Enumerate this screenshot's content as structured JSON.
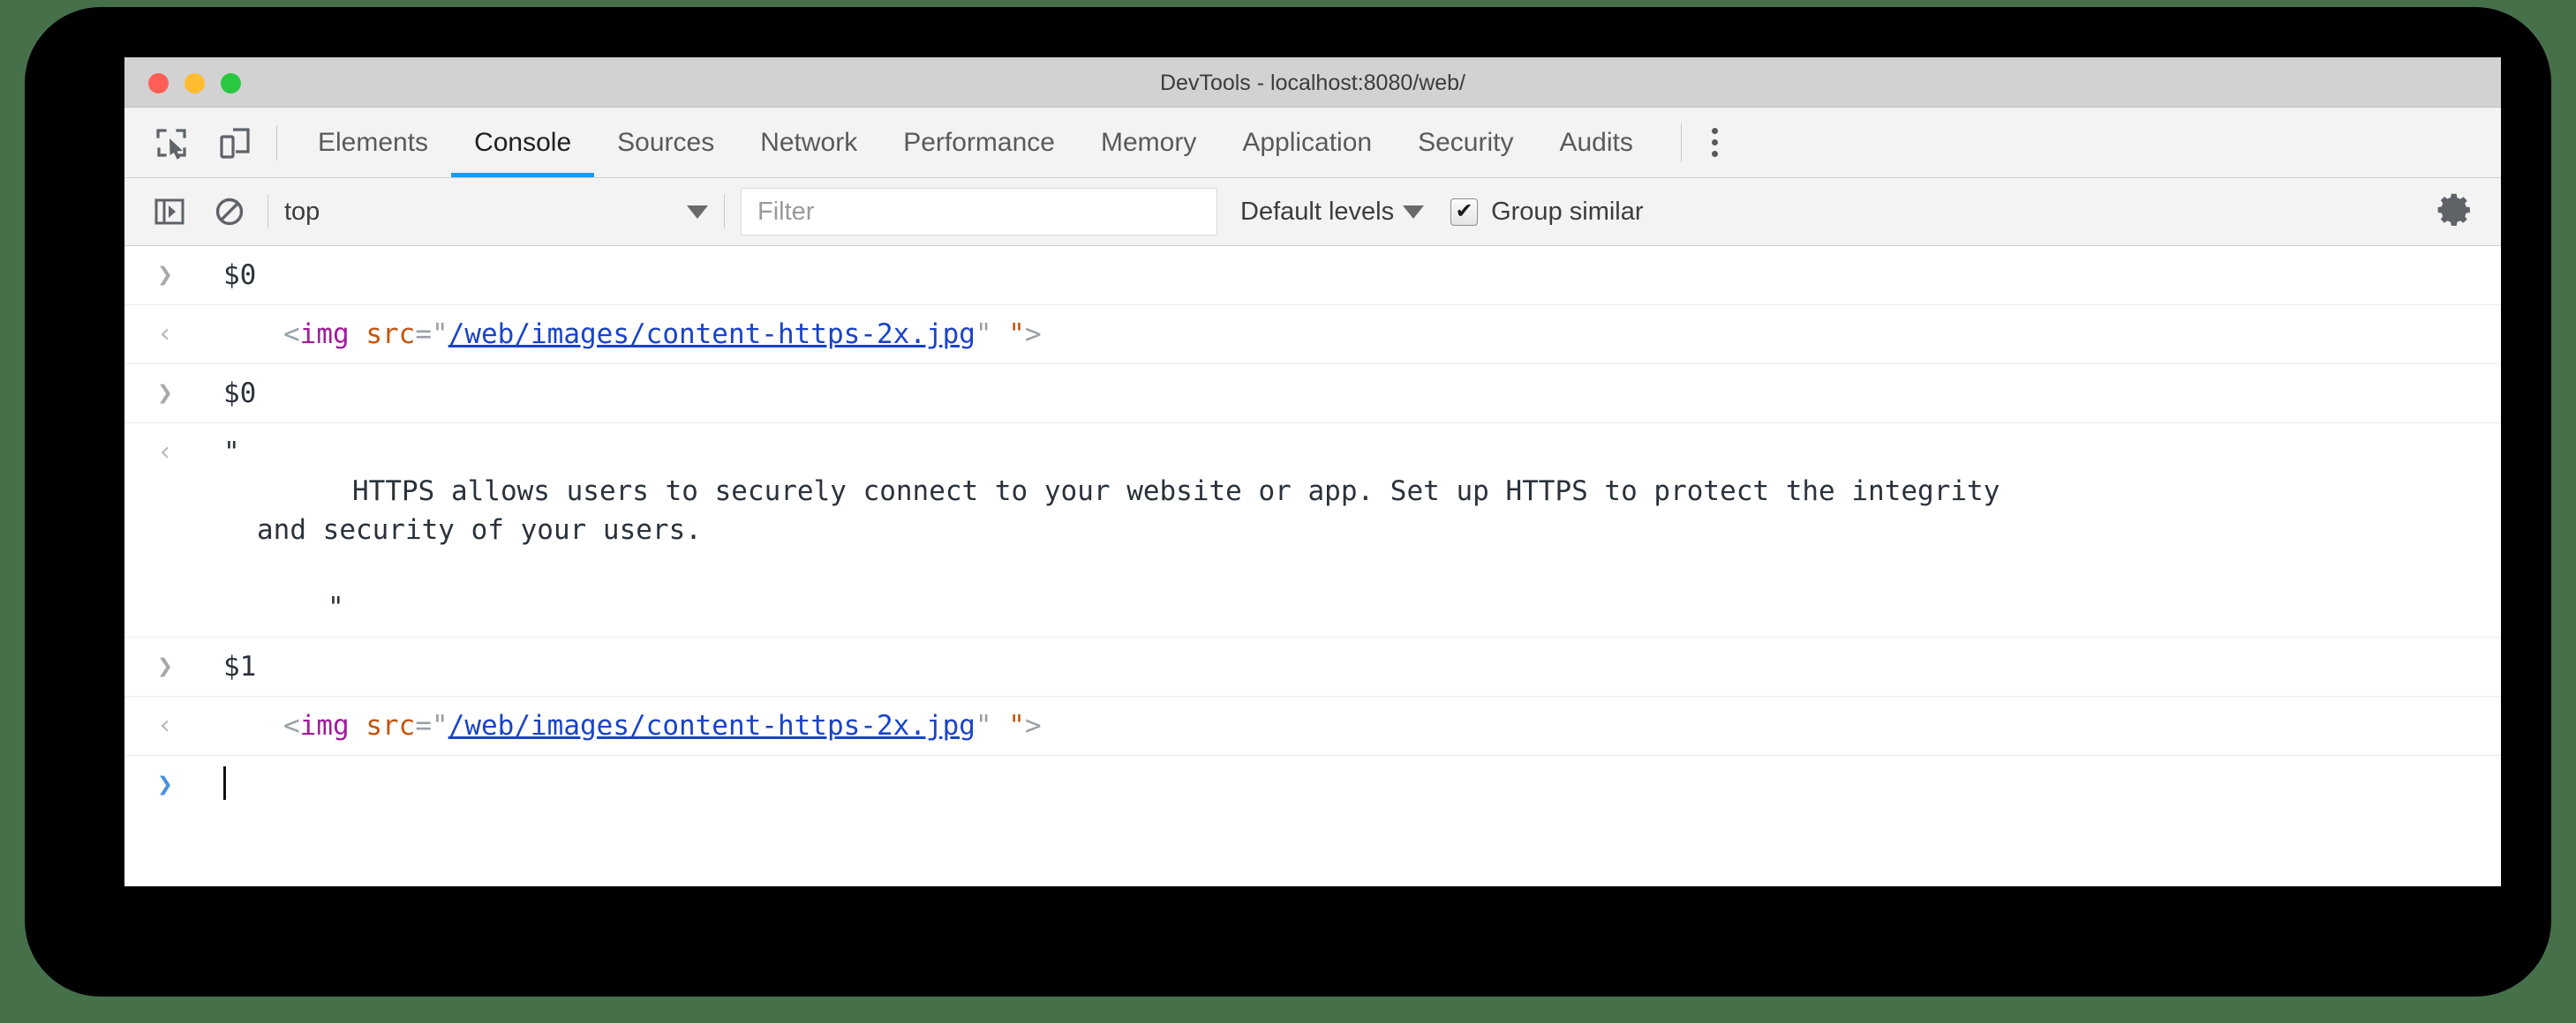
{
  "window": {
    "title": "DevTools - localhost:8080/web/",
    "traffic_lights": [
      {
        "name": "close",
        "color": "#ff5f57"
      },
      {
        "name": "minimize",
        "color": "#febc2e"
      },
      {
        "name": "maximize",
        "color": "#28c840"
      }
    ]
  },
  "toolbar_icons": {
    "inspect": "inspect-element-icon",
    "device": "device-toolbar-icon",
    "kebab": "more-options-icon"
  },
  "tabs": [
    {
      "label": "Elements",
      "active": false
    },
    {
      "label": "Console",
      "active": true
    },
    {
      "label": "Sources",
      "active": false
    },
    {
      "label": "Network",
      "active": false
    },
    {
      "label": "Performance",
      "active": false
    },
    {
      "label": "Memory",
      "active": false
    },
    {
      "label": "Application",
      "active": false
    },
    {
      "label": "Security",
      "active": false
    },
    {
      "label": "Audits",
      "active": false
    }
  ],
  "console_toolbar": {
    "sidebar_icon": "console-sidebar-icon",
    "clear_icon": "clear-console-icon",
    "context": "top",
    "context_caret": "chevron-down-icon",
    "filter_placeholder": "Filter",
    "filter_value": "",
    "levels": "Default levels",
    "levels_caret": "chevron-down-icon",
    "group_similar_label": "Group similar",
    "group_similar_checked": true,
    "group_similar_mark": "✔",
    "settings_icon": "settings-gear-icon"
  },
  "console_messages": [
    {
      "kind": "input",
      "gutter": "❯",
      "text": "$0"
    },
    {
      "kind": "output",
      "gutter": "‹",
      "html_parts": {
        "open": "<",
        "tag": "img",
        "space": " ",
        "attr": "src",
        "eq": "=",
        "quote_open": "\"",
        "url": "/web/images/content-https-2x.jpg",
        "quote_close": "\"",
        "orphan_quote": "\"",
        "close": ">"
      }
    },
    {
      "kind": "input",
      "gutter": "❯",
      "text": "$0"
    },
    {
      "kind": "output-string",
      "gutter": "‹",
      "quote_open": "\"",
      "line1": "HTTPS allows users to securely connect to your website or app. Set up HTTPS to protect the integrity",
      "line2": "and security of your users.",
      "quote_close": "\""
    },
    {
      "kind": "input",
      "gutter": "❯",
      "text": "$1"
    },
    {
      "kind": "output",
      "gutter": "‹",
      "html_parts": {
        "open": "<",
        "tag": "img",
        "space": " ",
        "attr": "src",
        "eq": "=",
        "quote_open": "\"",
        "url": "/web/images/content-https-2x.jpg",
        "quote_close": "\"",
        "orphan_quote": "\"",
        "close": ">"
      }
    }
  ],
  "prompt": {
    "gutter": "❯",
    "value": ""
  },
  "colors": {
    "accent": "#1a9bf0",
    "prompt_accent": "#4a90e2",
    "tag": "#a11b9b",
    "attribute": "#c2560f",
    "link": "#1a43c8",
    "punctuation": "#9aa0a6",
    "text": "#2b323b",
    "frame": "#000000",
    "backdrop": "#46704a"
  }
}
